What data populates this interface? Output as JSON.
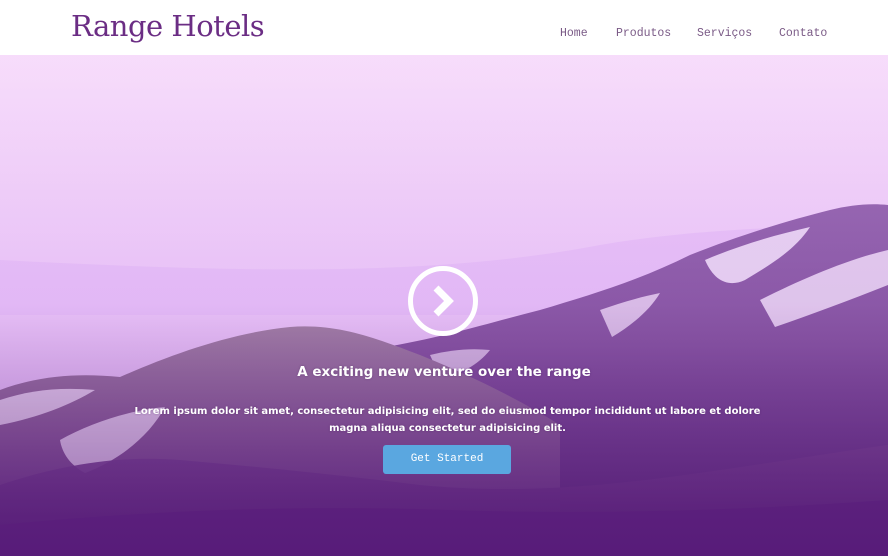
{
  "header": {
    "logo": "Range Hotels",
    "nav": {
      "home": "Home",
      "produtos": "Produtos",
      "servicos": "Serviços",
      "contato": "Contato"
    }
  },
  "hero": {
    "play_icon": "chevron-right-circle-icon",
    "title": "A exciting new venture over the range",
    "text": "Lorem ipsum dolor sit amet, consectetur adipisicing elit, sed do eiusmod tempor incididunt ut labore et dolore magna aliqua consectetur adipisicing elit.",
    "cta_label": "Get Started"
  },
  "colors": {
    "brand": "#6b2d84",
    "nav_text": "#7a5a86",
    "button": "#5aa7e0",
    "hero_top": "#f7d9fb",
    "hero_bottom": "#5e2380"
  }
}
